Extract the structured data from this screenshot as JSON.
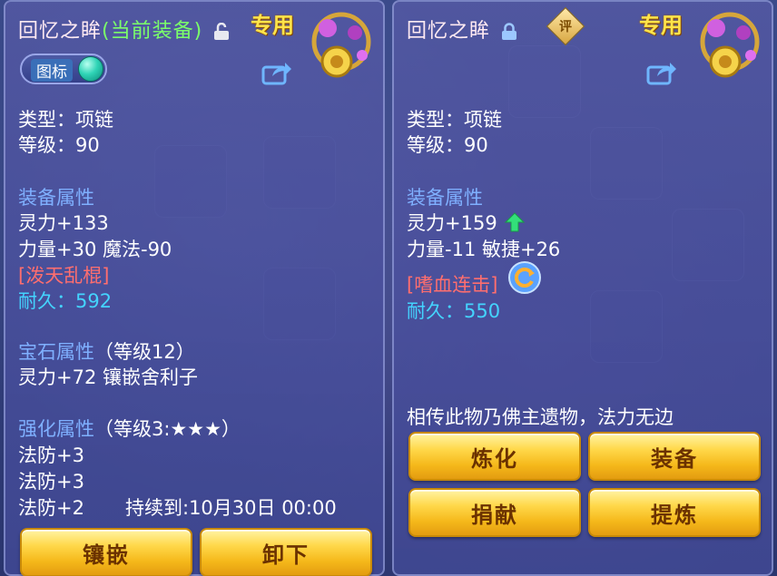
{
  "left": {
    "title": "回忆之眸",
    "equipped_tag": "(当前装备)",
    "special": "专用",
    "toggle_label": "图标",
    "type": "类型：项链",
    "level": "等级：90",
    "equip_attr_title": "装备属性",
    "attr1": "灵力+133",
    "attr2": "力量+30 魔法-90",
    "skill": "[泼天乱棍]",
    "durability": "耐久：592",
    "gem_title": "宝石属性",
    "gem_level": "（等级12）",
    "gem_attr": "灵力+72 镶嵌舍利子",
    "strengthen_title": "强化属性",
    "strengthen_level": "（等级3:★★★）",
    "str1": "法防+3",
    "str2": "法防+3",
    "str3": "法防+2",
    "duration": "持续到:10月30日 00:00",
    "btn_inlay": "镶嵌",
    "btn_remove": "卸下"
  },
  "right": {
    "title": "回忆之眸",
    "rating": "评",
    "special": "专用",
    "type": "类型：项链",
    "level": "等级：90",
    "equip_attr_title": "装备属性",
    "attr1": "灵力+159",
    "attr2": "力量-11 敏捷+26",
    "skill": "[嗜血连击]",
    "durability": "耐久：550",
    "description": "相传此物乃佛主遗物，法力无边",
    "btn_refine": "炼化",
    "btn_equip": "装备",
    "btn_donate": "捐献",
    "btn_extract": "提炼"
  },
  "colors": {
    "section": "#7fb0ff",
    "skill": "#ff6e6e",
    "durability": "#44d4ff",
    "equipped": "#7bff6a",
    "special": "#ffe44a"
  },
  "icons": [
    "unlock-icon",
    "lock-icon",
    "share-icon",
    "amulet-icon",
    "green-up-arrow-icon",
    "refresh-icon"
  ]
}
